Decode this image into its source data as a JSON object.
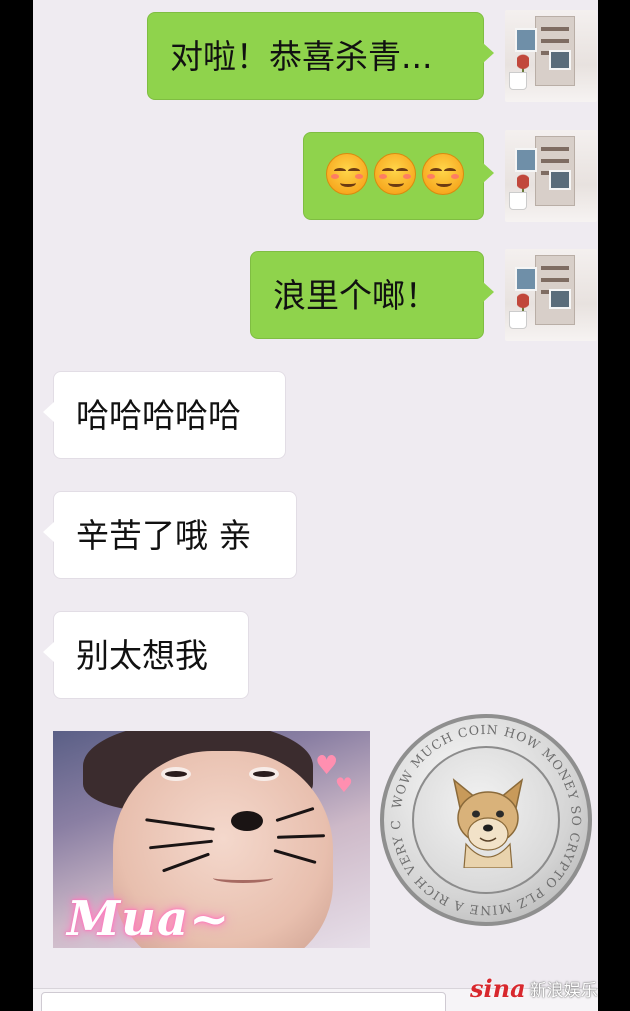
{
  "messages": [
    {
      "side": "out",
      "text": "对啦！恭喜杀青..."
    },
    {
      "side": "out",
      "emoji": [
        "blushing-smile-emoji",
        "blushing-smile-emoji",
        "blushing-smile-emoji"
      ]
    },
    {
      "side": "out",
      "text": "浪里个啷！"
    },
    {
      "side": "in",
      "text": "哈哈哈哈哈"
    },
    {
      "side": "in",
      "text": "辛苦了哦 亲"
    },
    {
      "side": "in",
      "text": "别太想我"
    }
  ],
  "stickers": {
    "cat_filter_text": "Mua~",
    "coin_ring_text": "WOW MUCH COIN HOW MONEY SO CRYPTO PLZ MINE A RICH VERY CURRENCY"
  },
  "watermark": {
    "logo": "sina",
    "text": "新浪娱乐"
  },
  "colors": {
    "outgoing_bubble": "#8fd34c",
    "incoming_bubble": "#ffffff",
    "chat_background": "#efebf1"
  }
}
